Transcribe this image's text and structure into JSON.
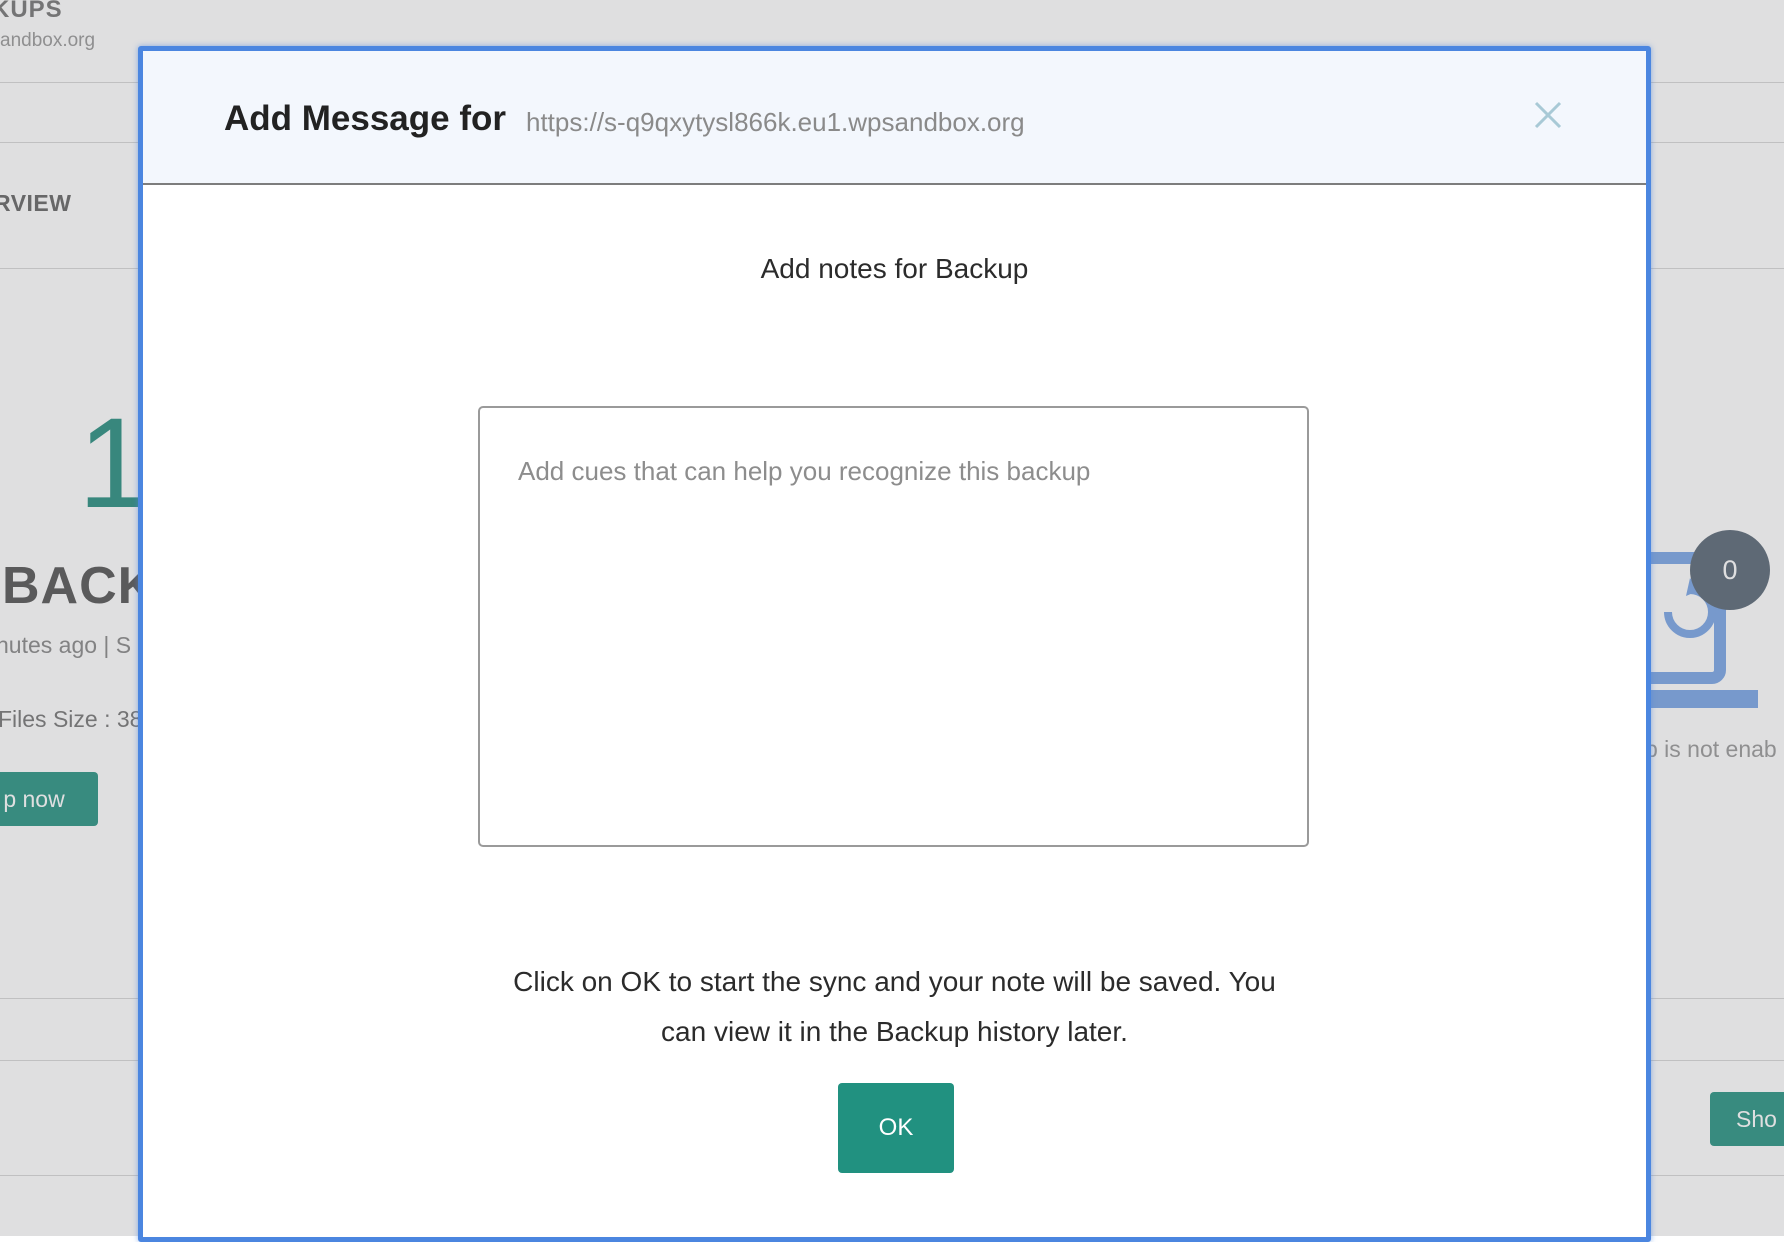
{
  "background": {
    "title": "KUPS",
    "site": "andbox.org",
    "section": "RVIEW",
    "backup_count": "1",
    "backups_label": "BACKU",
    "last_backup": "nutes ago  |  S",
    "files_size": "Files Size : 38",
    "backup_now_label": "p now",
    "badge_count": "0",
    "status_text": "p is not enab",
    "show_label": "Sho"
  },
  "modal": {
    "title": "Add Message for",
    "site_url": "https://s-q9qxytysl866k.eu1.wpsandbox.org",
    "close_icon": "close-icon",
    "subtitle": "Add notes for Backup",
    "notes_placeholder": "Add cues that can help you recognize this backup",
    "notes_value": "",
    "info_line1": "Click on OK to start the sync and your note will be saved. You",
    "info_line2": "can view it in the Backup history later.",
    "ok_label": "OK"
  },
  "colors": {
    "accent": "#219180",
    "modal_border": "#4b86e0",
    "header_bg": "#f3f7fd",
    "badge": "#5a6877",
    "laptop_icon": "#7aa6e6"
  }
}
